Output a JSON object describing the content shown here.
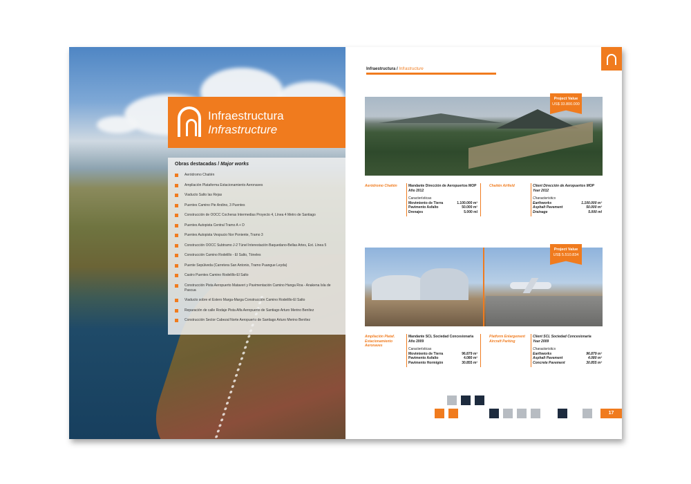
{
  "colors": {
    "accent": "#f07b1e",
    "navy": "#1d2b3e",
    "gray": "#b7bcc2"
  },
  "left": {
    "title_es": "Infraestructura",
    "title_en": "Infrastructure",
    "works_head_es": "Obras destacadas /",
    "works_head_en": "Major works",
    "works": [
      "Aeródromo Chaitén",
      "Ampliación Plataforma Estacionamiento Aeronaves",
      "Viaducto Salto las Rejas",
      "Puentes Camino Pie Andino, 3 Puentes",
      "Construcción de OOCC Cocheras Intermedias Proyecto 4, Línea 4 Metro de Santiago",
      "Puentes Autopista Central Tramo A + D",
      "Puentes Autopista Vespucio Nor Poniente, Tramo 3",
      "Construcción OOCC Subtramo J-2 Túnel Interestación Baquedano-Bellas Artes, Ext. Línea 5",
      "Construcción Camino Rodelillo - El Salto, Tóneles",
      "Puente Sepúlveda (Carretera San Antonio, Tramo Puangue Leyda)",
      "Castro Puentes Camino Rodelillo-El Salto",
      "Construcción Pista Aeropuerto Mataveri y Pavimentación Camino Hanga Roa - Anakena Isla de Pascua",
      "Viaducto sobre el Estero Marga-Marga Construcción Camino Rodelillo-El Salto",
      "Reparación de calle Rodaje Pista Alfa Aeropuerto de Santiago Arturo Merino Benítez",
      "Construcción Sector Cabezal Norte Aeropuerto de Santiago Arturo Merino Benítez"
    ]
  },
  "right": {
    "breadcrumb_es": "Infraestructura /",
    "breadcrumb_en": "Infrastructure",
    "page_number": "17",
    "project1": {
      "flag_title": "Project Value",
      "flag_value": "US$ 33.800.000",
      "name_es": "Aeródromo Chaitén",
      "client_es": "Mandante Dirección de Aeropuertos MOP",
      "year_es": "Año 2012",
      "chars_es": "Características",
      "rows_es": [
        {
          "k": "Movimiento de Tierra",
          "v": "1.100.000 m³"
        },
        {
          "k": "Pavimento Asfalto",
          "v": "50.000 m²"
        },
        {
          "k": "Drenajes",
          "v": "5.000 ml"
        }
      ],
      "name_en": "Chaitén Airfield",
      "client_en": "Client Dirección de Aeropuertos MOP",
      "year_en": "Year 2012",
      "chars_en": "Characteristics",
      "rows_en": [
        {
          "k": "Earthworks",
          "v": "1.100.000 m³"
        },
        {
          "k": "Asphalt Pavement",
          "v": "50.000 m²"
        },
        {
          "k": "Drainage",
          "v": "5.000 ml"
        }
      ]
    },
    "project2": {
      "flag_title": "Project Value",
      "flag_value": "US$ 5.510.834",
      "name_es": "Ampliación Plataf. Estacionamiento Aeronaves",
      "client_es": "Mandante SCL Sociedad Concesionaria",
      "year_es": "Año 2009",
      "chars_es": "Características",
      "rows_es": [
        {
          "k": "Movimiento de Tierra",
          "v": "96.879 m³"
        },
        {
          "k": "Pavimento Asfalto",
          "v": "4.080 m²"
        },
        {
          "k": "Pavimento Hormigón",
          "v": "30.855 m²"
        }
      ],
      "name_en": "Platform Enlargement Aircraft Parking",
      "client_en": "Client SCL Sociedad Concesionaria",
      "year_en": "Year 2009",
      "chars_en": "Characteristics",
      "rows_en": [
        {
          "k": "Earthworks",
          "v": "96.879 m³"
        },
        {
          "k": "Asphalt Pavement",
          "v": "4.080 m²"
        },
        {
          "k": "Concrete Pavement",
          "v": "30.855 m²"
        }
      ]
    }
  }
}
